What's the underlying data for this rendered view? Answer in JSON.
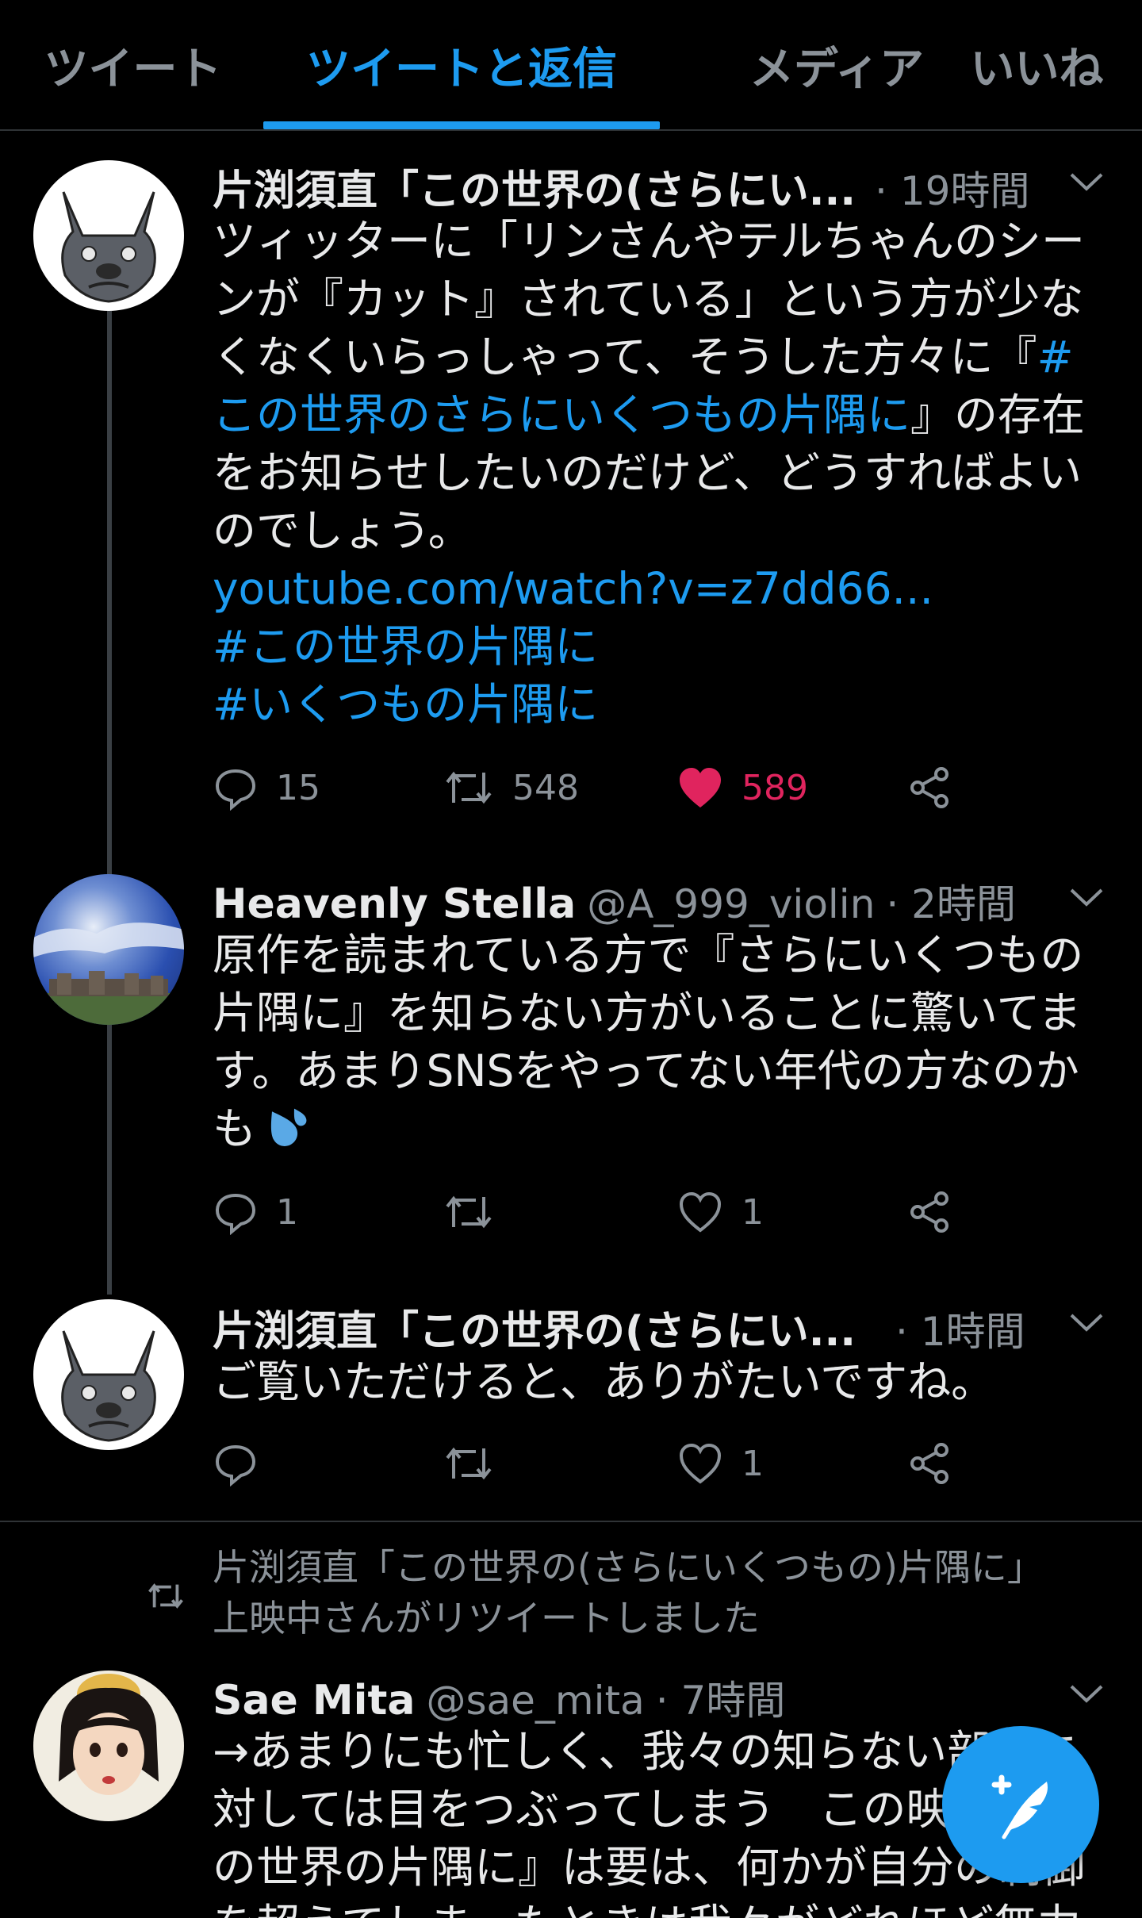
{
  "tabs": [
    {
      "label": "ツイート"
    },
    {
      "label": "ツイートと返信"
    },
    {
      "label": "メディア"
    },
    {
      "label": "いいね"
    }
  ],
  "tweets": [
    {
      "name": "片渕須直「この世界の(さらにい...",
      "time": "· 19時間",
      "lines": [
        "ツィッターに「リンさんやテルちゃんのシー",
        "ンが『カット』されている」という方が少な",
        "くなくいらっしゃって、そうした方々に『"
      ],
      "hashtag_start": "#",
      "line4_link": "この世界のさらにいくつもの片隅に",
      "line4_rest": "』の存在",
      "lines_after": [
        "をお知らせしたいのだけど、どうすればよい",
        "のでしょう。"
      ],
      "url": "youtube.com/watch?v=z7dd66...",
      "hashtags": [
        "#この世界の片隅に",
        "#いくつもの片隅に"
      ],
      "replies": "15",
      "retweets": "548",
      "likes": "589"
    },
    {
      "name": "Heavenly Stella",
      "handle": "@A_999_violin",
      "time": "· 2時間",
      "lines": [
        "原作を読まれている方で『さらにいくつもの",
        "片隅に』を知らない方がいることに驚いてま",
        "す。あまりSNSをやってない年代の方なのか",
        "も"
      ],
      "replies": "1",
      "retweets": "",
      "likes": "1"
    },
    {
      "name": "片渕須直「この世界の(さらにい...",
      "time": "· 1時間",
      "lines": [
        "ご覧いただけると、ありがたいですね。"
      ],
      "replies": "",
      "retweets": "",
      "likes": "1"
    },
    {
      "retweet_note": [
        "片渕須直「この世界の(さらにいくつもの)片隅に」",
        "上映中さんがリツイートしました"
      ],
      "name": "Sae Mita",
      "handle": "@sae_mita",
      "time": "· 7時間",
      "lines": [
        "→あまりにも忙しく、我々の知らない部分に",
        "対しては目をつぶってしまう　この映画『こ",
        "の世界の片隅に』は要は、何かが自分の制御",
        "を超えてしまったときは我々がどれほど無力"
      ]
    }
  ],
  "colors": {
    "accent": "#1d9bf0",
    "like": "#e0245e",
    "muted": "#8b9299",
    "background": "#000000"
  }
}
